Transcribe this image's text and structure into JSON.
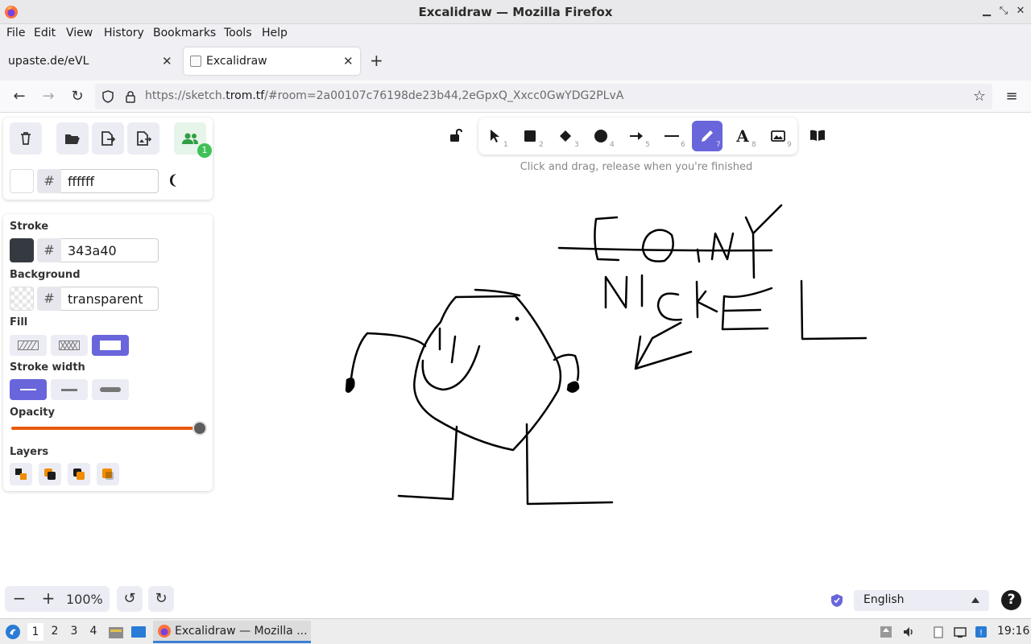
{
  "window": {
    "title": "Excalidraw — Mozilla Firefox"
  },
  "menubar": {
    "items": [
      "File",
      "Edit",
      "View",
      "History",
      "Bookmarks",
      "Tools",
      "Help"
    ]
  },
  "tabs": [
    {
      "label": "upaste.de/eVL",
      "active": false
    },
    {
      "label": "Excalidraw",
      "active": true
    }
  ],
  "navbar": {
    "url_prefix": "https://sketch.",
    "url_host": "trom.tf",
    "url_rest": "/#room=2a00107c76198de23b44,2eGpxQ_Xxcc0GwYDG2PLvA"
  },
  "canvas_panel": {
    "bg_hash": "#",
    "bg_value": "ffffff",
    "collaborators_count": "1"
  },
  "props": {
    "stroke_label": "Stroke",
    "stroke_hash": "#",
    "stroke_value": "343a40",
    "stroke_color": "#343a40",
    "background_label": "Background",
    "background_hash": "#",
    "background_value": "transparent",
    "fill_label": "Fill",
    "fill_options": [
      "hachure",
      "cross-hatch",
      "solid"
    ],
    "fill_selected": "solid",
    "stroke_width_label": "Stroke width",
    "stroke_width_options": [
      "thin",
      "bold",
      "extra-bold"
    ],
    "stroke_width_selected": "thin",
    "opacity_label": "Opacity",
    "opacity_value": 1.0,
    "layers_label": "Layers"
  },
  "toolbar": {
    "tools": [
      {
        "name": "selection",
        "num": "1"
      },
      {
        "name": "rectangle",
        "num": "2"
      },
      {
        "name": "diamond",
        "num": "3"
      },
      {
        "name": "ellipse",
        "num": "4"
      },
      {
        "name": "arrow",
        "num": "5"
      },
      {
        "name": "line",
        "num": "6"
      },
      {
        "name": "draw",
        "num": "7",
        "selected": true
      },
      {
        "name": "text",
        "num": "8"
      },
      {
        "name": "image",
        "num": "9"
      }
    ],
    "hint": "Click and drag, release when you're finished",
    "accent": "#6965db"
  },
  "footer": {
    "zoom": "100%",
    "language": "English"
  },
  "taskbar": {
    "workspaces": [
      "1",
      "2",
      "3",
      "4"
    ],
    "current_workspace": "1",
    "task_label": "Excalidraw — Mozilla ...",
    "clock": "19:16"
  }
}
